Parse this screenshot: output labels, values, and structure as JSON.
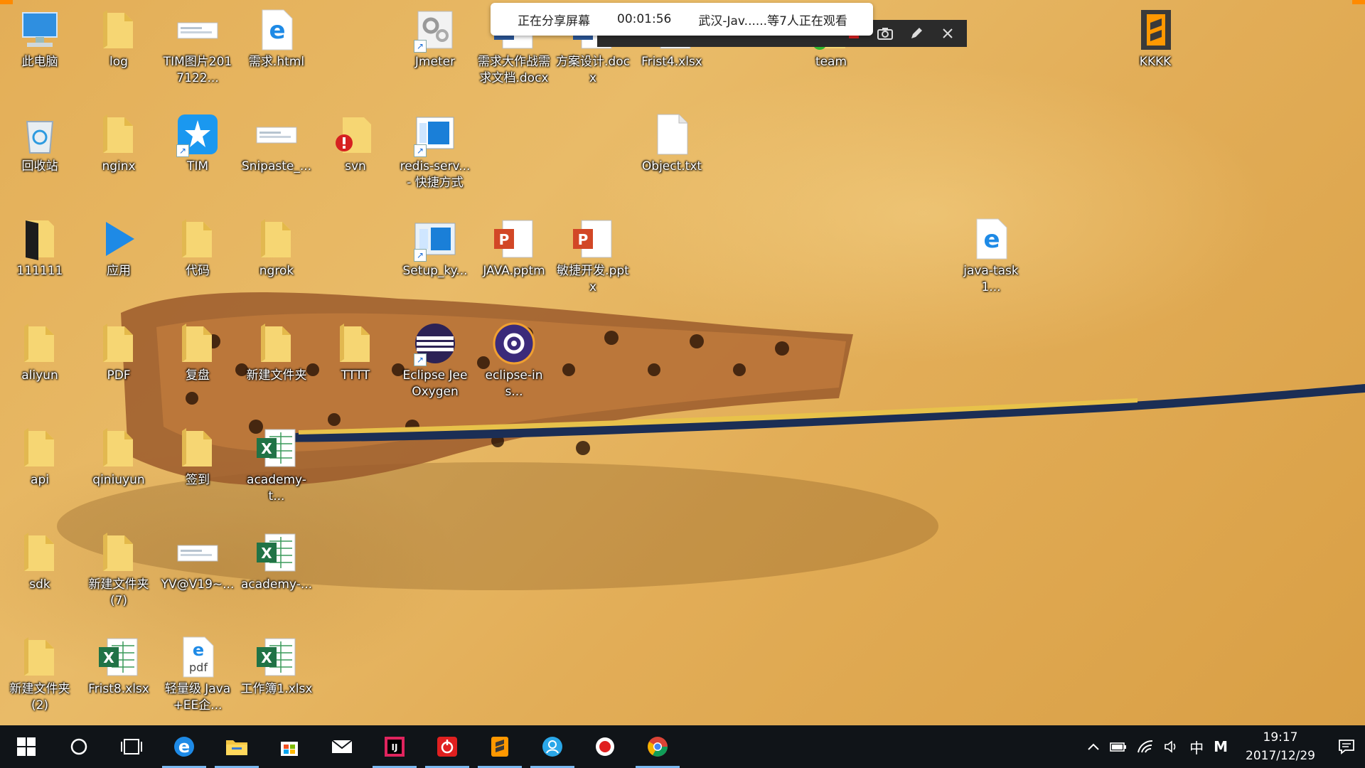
{
  "share_bar": {
    "status": "正在分享屏幕",
    "elapsed": "00:01:56",
    "viewers": "武汉-Jav......等7人正在观看"
  },
  "desktop_icons": [
    {
      "label": "此电脑",
      "icon": "computer-icon"
    },
    {
      "label": "log",
      "icon": "folder-icon"
    },
    {
      "label": "TIM图片2017122...",
      "icon": "image-file-icon"
    },
    {
      "label": "需求.html",
      "icon": "edge-html-icon"
    },
    {
      "label": "Jmeter",
      "icon": "gear-shortcut-icon"
    },
    {
      "label": "需求大作战需求文档.docx",
      "icon": "word-doc-icon"
    },
    {
      "label": "方案设计.docx",
      "icon": "word-doc-icon"
    },
    {
      "label": "Frist4.xlsx",
      "icon": "excel-icon"
    },
    {
      "label": "team",
      "icon": "green-check-folder-icon"
    },
    {
      "label": "KKKK",
      "icon": "sublime-file-icon"
    },
    {
      "label": "回收站",
      "icon": "recycle-bin-icon"
    },
    {
      "label": "nginx",
      "icon": "folder-icon"
    },
    {
      "label": "TIM",
      "icon": "tim-app-icon"
    },
    {
      "label": "Snipaste_...",
      "icon": "image-file-icon"
    },
    {
      "label": "svn",
      "icon": "svn-folder-icon"
    },
    {
      "label": "redis-serv... - 快捷方式",
      "icon": "app-shortcut-icon"
    },
    {
      "label": "Object.txt",
      "icon": "text-file-icon"
    },
    {
      "label": "111111",
      "icon": "black-folder-icon"
    },
    {
      "label": "应用",
      "icon": "play-arrow-icon"
    },
    {
      "label": "代码",
      "icon": "folder-icon"
    },
    {
      "label": "ngrok",
      "icon": "folder-icon"
    },
    {
      "label": "Setup_ky...",
      "icon": "app-window-icon"
    },
    {
      "label": "JAVA.pptm",
      "icon": "powerpoint-icon"
    },
    {
      "label": "敏捷开发.pptx",
      "icon": "powerpoint-icon"
    },
    {
      "label": "java-task1...",
      "icon": "edge-html-icon"
    },
    {
      "label": "aliyun",
      "icon": "folder-icon"
    },
    {
      "label": "PDF",
      "icon": "folder-icon"
    },
    {
      "label": "复盘",
      "icon": "folder-icon"
    },
    {
      "label": "新建文件夹",
      "icon": "folder-icon"
    },
    {
      "label": "TTTT",
      "icon": "folder-icon"
    },
    {
      "label": "Eclipse Jee Oxygen",
      "icon": "eclipse-icon"
    },
    {
      "label": "eclipse-ins...",
      "icon": "eclipse-installer-icon"
    },
    {
      "label": "api",
      "icon": "folder-icon"
    },
    {
      "label": "qiniuyun",
      "icon": "folder-icon"
    },
    {
      "label": "签到",
      "icon": "folder-icon"
    },
    {
      "label": "academy-t...",
      "icon": "excel-icon"
    },
    {
      "label": "sdk",
      "icon": "folder-icon"
    },
    {
      "label": "新建文件夹 (7)",
      "icon": "folder-icon"
    },
    {
      "label": "YV@V19~...",
      "icon": "image-file-icon"
    },
    {
      "label": "academy-...",
      "icon": "excel-icon"
    },
    {
      "label": "新建文件夹 (2)",
      "icon": "folder-icon"
    },
    {
      "label": "Frist8.xlsx",
      "icon": "excel-icon"
    },
    {
      "label": "轻量级 Java+EE企...",
      "icon": "pdf-icon"
    },
    {
      "label": "工作簿1.xlsx",
      "icon": "excel-icon"
    }
  ],
  "taskbar": {
    "items": [
      {
        "name": "start-button",
        "icon": "windows-icon"
      },
      {
        "name": "cortana-button",
        "icon": "circle-icon"
      },
      {
        "name": "task-view-button",
        "icon": "task-view-icon"
      },
      {
        "name": "taskbar-edge",
        "icon": "edge-icon"
      },
      {
        "name": "taskbar-file-explorer",
        "icon": "folder-icon"
      },
      {
        "name": "taskbar-store",
        "icon": "store-icon"
      },
      {
        "name": "taskbar-mail",
        "icon": "mail-icon"
      },
      {
        "name": "taskbar-intellij",
        "icon": "intellij-icon"
      },
      {
        "name": "taskbar-netease-music",
        "icon": "netease-music-icon"
      },
      {
        "name": "taskbar-sublime",
        "icon": "sublime-icon"
      },
      {
        "name": "taskbar-tim",
        "icon": "tim-icon"
      },
      {
        "name": "taskbar-recorder",
        "icon": "record-icon"
      },
      {
        "name": "taskbar-chrome",
        "icon": "chrome-icon"
      }
    ],
    "tray": {
      "ime": "中",
      "ime_mode": "M",
      "time": "19:17",
      "date": "2017/12/29"
    }
  }
}
